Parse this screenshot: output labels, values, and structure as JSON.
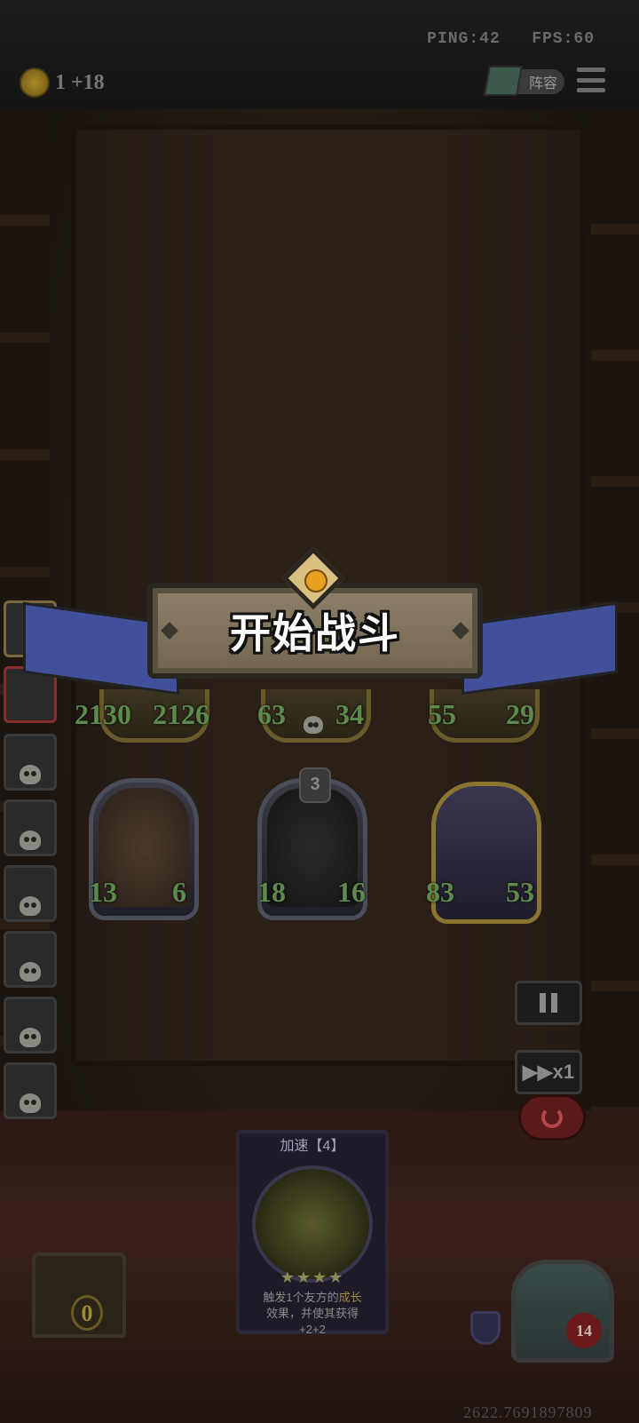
{
  "status": {
    "ping": "PING:42",
    "fps": "FPS:60"
  },
  "gold": {
    "amount": "1",
    "bonus": "+18"
  },
  "header": {
    "lineup_label": "阵容"
  },
  "banner": {
    "text": "开始战斗"
  },
  "enemy_row": [
    {
      "attack": "2130",
      "health": "2126"
    },
    {
      "attack": "63",
      "health": "34"
    },
    {
      "attack": "55",
      "health": "29"
    }
  ],
  "player_row": [
    {
      "attack": "13",
      "health": "6"
    },
    {
      "attack": "18",
      "health": "16",
      "badge": "3"
    },
    {
      "attack": "83",
      "health": "53"
    }
  ],
  "controls": {
    "speed_label": "▶▶x1"
  },
  "skill_card": {
    "title": "加速【4】",
    "stars": "★★★★",
    "desc_prefix": "触发1个友方的",
    "desc_highlight": "成长",
    "desc_line2": "效果，并使其获得",
    "desc_line3": "+2+2"
  },
  "chest_count": "0",
  "player_health": "14",
  "score": "2622.7691897809"
}
